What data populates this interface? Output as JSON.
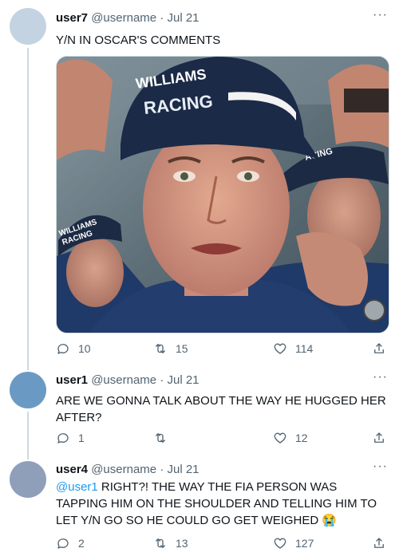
{
  "tweets": [
    {
      "name": "user7",
      "handle": "@username",
      "date": "Jul 21",
      "text": "Y/N IN OSCAR'S COMMENTS",
      "replies": "10",
      "retweets": "15",
      "likes": "114",
      "avatar_color": "#c4d3e1",
      "media": {
        "cap_text_main": "RACING",
        "cap_text_main_top": "WILLIAMS",
        "cap_text_left_1": "WILLIAMS",
        "cap_text_left_2": "RACING",
        "cap_text_right": "ACING"
      }
    },
    {
      "name": "user1",
      "handle": "@username",
      "date": "Jul 21",
      "text": "ARE WE GONNA TALK ABOUT THE WAY HE HUGGED HER AFTER?",
      "replies": "1",
      "retweets": "",
      "likes": "12",
      "avatar_color": "#6a9ac4"
    },
    {
      "name": "user4",
      "handle": "@username",
      "date": "Jul 21",
      "mention": "@user1",
      "text": " RIGHT?! THE WAY THE FIA PERSON WAS TAPPING HIM ON THE SHOULDER AND TELLING HIM TO LET Y/N GO SO HE COULD GO GET WEIGHED 😭",
      "replies": "2",
      "retweets": "13",
      "likes": "127",
      "avatar_color": "#8f9fba"
    }
  ],
  "separator": "·",
  "more_label": "···",
  "colors": {
    "line": "#cfd9de",
    "muted": "#536471",
    "link": "#1d9bf0"
  }
}
